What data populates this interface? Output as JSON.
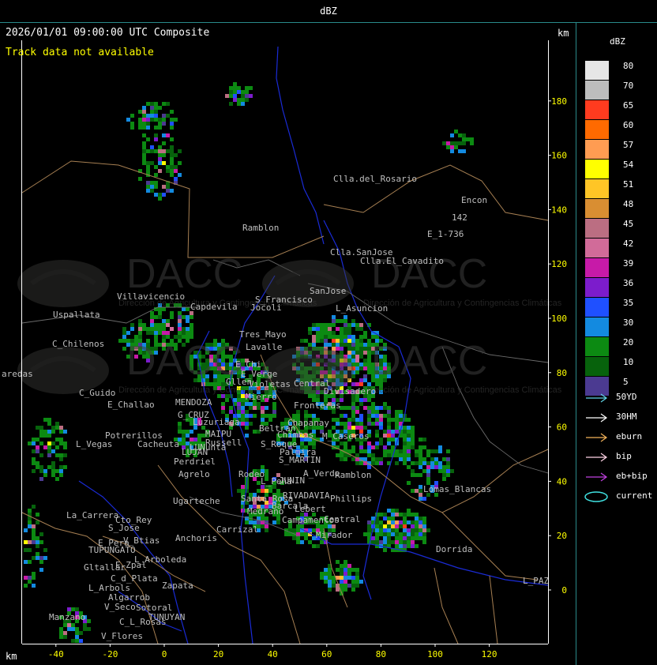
{
  "window": {
    "title": "dBZ"
  },
  "header": {
    "timestamp": "2026/01/01 09:00:00 UTC Composite",
    "track_status": "Track data not available",
    "unit_top": "km",
    "unit_bottom": "km"
  },
  "axes": {
    "x_ticks": [
      "-40",
      "-20",
      "0",
      "20",
      "40",
      "60",
      "80",
      "100",
      "120"
    ],
    "y_ticks": [
      "180",
      "160",
      "140",
      "120",
      "100",
      "80",
      "60",
      "40",
      "20",
      "0"
    ]
  },
  "watermark": {
    "text": "DACC",
    "subtitle": "Dirección de Agricultura y Contingencias Climáticas"
  },
  "places": [
    {
      "name": "Clla.del_Rosario"
    },
    {
      "name": "Encon"
    },
    {
      "name": "142"
    },
    {
      "name": "E_1-736"
    },
    {
      "name": "Ramblon"
    },
    {
      "name": "Clla.SanJose"
    },
    {
      "name": "Clla.El_Cavadito"
    },
    {
      "name": "Villavicencio"
    },
    {
      "name": "Uspallata"
    },
    {
      "name": "Capdevila"
    },
    {
      "name": "S_Francisco"
    },
    {
      "name": "Jocoli"
    },
    {
      "name": "SanJose"
    },
    {
      "name": "L_Asuncion"
    },
    {
      "name": "C_Chilenos"
    },
    {
      "name": "Tres_Mayo"
    },
    {
      "name": "Lavalle"
    },
    {
      "name": "aredas"
    },
    {
      "name": "E_Chi"
    },
    {
      "name": "E_Verge"
    },
    {
      "name": "Gllen"
    },
    {
      "name": "Violetas"
    },
    {
      "name": "Central"
    },
    {
      "name": "Divisadero"
    },
    {
      "name": "C_Guido"
    },
    {
      "name": "E_Challao"
    },
    {
      "name": "MENDOZA"
    },
    {
      "name": "Mierro"
    },
    {
      "name": "Fronteras"
    },
    {
      "name": "G_CRUZ"
    },
    {
      "name": "Chapanay"
    },
    {
      "name": "Luzuriaga"
    },
    {
      "name": "Beltran"
    },
    {
      "name": "Chimbas"
    },
    {
      "name": "M_Caseros"
    },
    {
      "name": "Potrerillos"
    },
    {
      "name": "Cacheuta"
    },
    {
      "name": "MAIPU"
    },
    {
      "name": "Russell"
    },
    {
      "name": "S_Roque"
    },
    {
      "name": "L_Vegas"
    },
    {
      "name": "LUJAN"
    },
    {
      "name": "LUNunta"
    },
    {
      "name": "Palmira"
    },
    {
      "name": "Perdriel"
    },
    {
      "name": "S_MARTIN"
    },
    {
      "name": "A_Verde"
    },
    {
      "name": "Ramblon"
    },
    {
      "name": "Agrelo"
    },
    {
      "name": "Rodeo"
    },
    {
      "name": "L_Peña"
    },
    {
      "name": "JUNIN"
    },
    {
      "name": "Lomas_Blancas"
    },
    {
      "name": "Ugarteche"
    },
    {
      "name": "RIVADAVIA"
    },
    {
      "name": "Phillips"
    },
    {
      "name": "Santa_Rosa"
    },
    {
      "name": "Barcala"
    },
    {
      "name": "Medrano"
    },
    {
      "name": "Lebert"
    },
    {
      "name": "La_Carrera"
    },
    {
      "name": "Cto_Rey"
    },
    {
      "name": "S_Jose"
    },
    {
      "name": "Campamentos"
    },
    {
      "name": "Central"
    },
    {
      "name": "Carrizal"
    },
    {
      "name": "Mirador"
    },
    {
      "name": "Dorrida"
    },
    {
      "name": "E_Pera"
    },
    {
      "name": "V_Btias"
    },
    {
      "name": "Anchoris"
    },
    {
      "name": "TUPUNGATO"
    },
    {
      "name": "L_Arboleda"
    },
    {
      "name": "Gltallar"
    },
    {
      "name": "E_Zpal"
    },
    {
      "name": "L_Arbols"
    },
    {
      "name": "C_d_Plata"
    },
    {
      "name": "Algarrob"
    },
    {
      "name": "V_Seco"
    },
    {
      "name": "Zapata"
    },
    {
      "name": "Sotoral"
    },
    {
      "name": "TUNUYAN"
    },
    {
      "name": "C_L_Rosas"
    },
    {
      "name": "Manzano"
    },
    {
      "name": "V_Flores"
    },
    {
      "name": "L_PAZ"
    }
  ],
  "legend": {
    "title": "dBZ",
    "levels": [
      {
        "value": "80",
        "color": "#e6e6e6"
      },
      {
        "value": "70",
        "color": "#bdbdbd"
      },
      {
        "value": "65",
        "color": "#ff3b1f"
      },
      {
        "value": "60",
        "color": "#ff6a00"
      },
      {
        "value": "57",
        "color": "#ff9c52"
      },
      {
        "value": "54",
        "color": "#ffff00"
      },
      {
        "value": "51",
        "color": "#ffc526"
      },
      {
        "value": "48",
        "color": "#d98e32"
      },
      {
        "value": "45",
        "color": "#bb6e82"
      },
      {
        "value": "42",
        "color": "#d16b99"
      },
      {
        "value": "39",
        "color": "#c71aa8"
      },
      {
        "value": "36",
        "color": "#7c1ccc"
      },
      {
        "value": "35",
        "color": "#1f50ff"
      },
      {
        "value": "30",
        "color": "#138ae0"
      },
      {
        "value": "20",
        "color": "#0c8a12"
      },
      {
        "value": "10",
        "color": "#07620c"
      },
      {
        "value": "5",
        "color": "#4b3a91"
      }
    ],
    "tracks": [
      {
        "label": "50YD",
        "color": "#5fd3e6",
        "icon": "arrow-icon"
      },
      {
        "label": "30HM",
        "color": "#ffffff",
        "icon": "arrow-icon"
      },
      {
        "label": "eburn",
        "color": "#f2b35a",
        "icon": "arrow-icon"
      },
      {
        "label": "bip",
        "color": "#ffd4e6",
        "icon": "arrow-icon"
      },
      {
        "label": "eb+bip",
        "color": "#c040e0",
        "icon": "arrow-icon"
      },
      {
        "label": "current",
        "color": "#3fe0e0",
        "icon": "ellipse-icon"
      }
    ]
  }
}
